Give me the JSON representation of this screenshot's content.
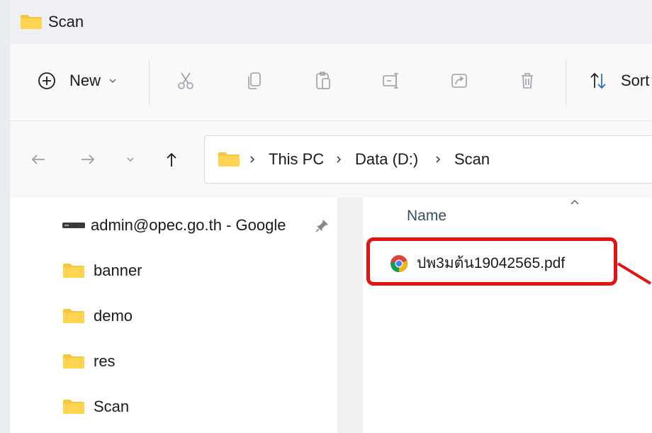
{
  "window": {
    "title": "Scan"
  },
  "toolbar": {
    "new_label": "New",
    "sort_label": "Sort",
    "icons": [
      "add-icon",
      "cut-icon",
      "copy-icon",
      "paste-icon",
      "rename-icon",
      "share-icon",
      "delete-icon",
      "sort-icon"
    ]
  },
  "addressbar": {
    "crumbs": [
      "This PC",
      "Data (D:)",
      "Scan"
    ]
  },
  "sidebar": {
    "items": [
      {
        "label": "admin@opec.go.th - Google",
        "icon": "drive-icon"
      },
      {
        "label": "banner",
        "icon": "folder-icon"
      },
      {
        "label": "demo",
        "icon": "folder-icon"
      },
      {
        "label": "res",
        "icon": "folder-icon"
      },
      {
        "label": "Scan",
        "icon": "folder-icon"
      }
    ]
  },
  "filelist": {
    "column_name": "Name",
    "files": [
      {
        "name": "ปพ3มต้น19042565.pdf",
        "icon": "chrome-icon"
      }
    ]
  },
  "colors": {
    "highlight": "#e21313",
    "folder": "#f5c63b",
    "window_bg": "#f3f3f3"
  }
}
